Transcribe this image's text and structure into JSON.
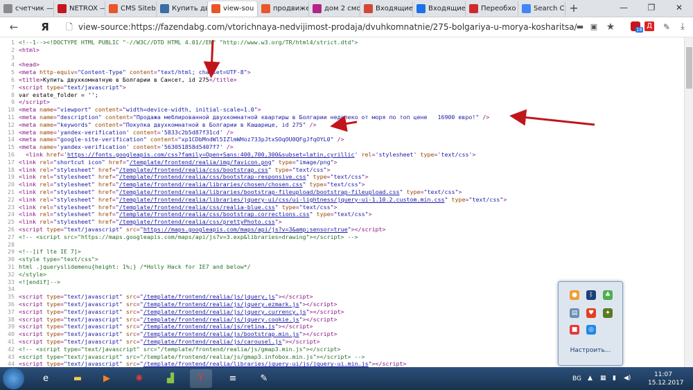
{
  "browser": {
    "tabs": [
      {
        "label": "счетчик —",
        "icon": "page-icon",
        "color": "#8a8a8a"
      },
      {
        "label": "NETROX —",
        "icon": "netrox-icon",
        "color": "#c4161c"
      },
      {
        "label": "CMS Siteb",
        "icon": "s-icon",
        "color": "#e8562a"
      },
      {
        "label": "Купить дву",
        "icon": "house-icon",
        "color": "#3a6ea5"
      },
      {
        "label": "view-sou",
        "icon": "s-icon",
        "color": "#e8562a"
      },
      {
        "label": "продвижен",
        "icon": "s-icon",
        "color": "#e8562a"
      },
      {
        "label": "дом 2 смо",
        "icon": "dom2-icon",
        "color": "#b32485"
      },
      {
        "label": "Входящие",
        "icon": "mail-icon",
        "color": "#d44638"
      },
      {
        "label": "Входящие",
        "icon": "mail-icon",
        "color": "#1a73e8"
      },
      {
        "label": "Переобхо",
        "icon": "search-icon",
        "color": "#cc2b2b"
      },
      {
        "label": "Search Co",
        "icon": "search-icon",
        "color": "#4285f4"
      }
    ],
    "new_tab": "+",
    "url": "view-source:https://fazendabg.com/vtorichnaya-nedvijimost-prodaja/dvuhkomnatnie/275-bolgariya-u-morya-kosharitsa/",
    "yandex_logo": "Я",
    "ext_badge": "18",
    "ext_d": "Д"
  },
  "source_lines": [
    {
      "n": "1",
      "html": "<span class='c'>&lt;!--1--&gt;&lt;!DOCTYPE HTML PUBLIC \"-//W3C//DTD HTML 4.01//EN\" \"http://www.w3.org/TR/html4/strict.dtd\"&gt;</span>"
    },
    {
      "n": "2",
      "html": "&lt;html&gt;"
    },
    {
      "n": "3",
      "html": ""
    },
    {
      "n": "4",
      "html": "&lt;head&gt;"
    },
    {
      "n": "5",
      "html": "&lt;meta <span class='a'>http-equiv</span>=<span class='v'>\"Content-Type\"</span> <span class='a'>content</span>=<span class='v'>\"text/html; charset=UTF-8\"</span>&gt;"
    },
    {
      "n": "6",
      "html": "&lt;title&gt;<span class='t'>Купить двухкомнатную в Болгарии в Сансет, id 275</span>&lt;/title&gt;"
    },
    {
      "n": "7",
      "html": "&lt;script <span class='a'>type</span>=<span class='v'>\"text/javascript\"</span>&gt;"
    },
    {
      "n": "8",
      "html": "<span class='t'>var estate_folder = '';</span>"
    },
    {
      "n": "9",
      "html": "&lt;/script&gt;"
    },
    {
      "n": "10",
      "html": "&lt;meta <span class='a'>name</span>=<span class='v'>\"viewport\"</span> <span class='a'>content</span>=<span class='v'>\"width=device-width, initial-scale=1.0\"</span>&gt;"
    },
    {
      "n": "11",
      "html": "&lt;meta <span class='a'>name</span>=<span class='v'>\"description\"</span> <span class='a'>content</span>=<span class='v'>\"Продажа меблированной двухкомнатной квартиры в Болгарии недалеко от моря по топ цене   16900 евро!\"</span> /&gt;"
    },
    {
      "n": "12",
      "html": "&lt;meta <span class='a'>name</span>=<span class='v'>\"keywords\"</span> <span class='a'>content</span>=<span class='v'>\"Покупка двухкомнатной в Болгарии в Кашарице, id 275\"</span> /&gt;"
    },
    {
      "n": "13",
      "html": "&lt;meta <span class='a'>name</span>=<span class='v'>'yandex-verification'</span> <span class='a'>content</span>=<span class='v'>'5833c2b5d87f31cd'</span> /&gt;"
    },
    {
      "n": "14",
      "html": "&lt;meta <span class='a'>name</span>=<span class='v'>\"google-site-verification\"</span> <span class='a'>content</span>=<span class='v'>\"xp1CDbMndWl5IZlmWHoz733pJtxSOqOU0QFgJfqOYL0\"</span> /&gt;"
    },
    {
      "n": "15",
      "html": "&lt;meta <span class='a'>name</span>=<span class='v'>'yandex-verification'</span> <span class='a'>content</span>=<span class='v'>'563051858d5407f7'</span> /&gt;"
    },
    {
      "n": "16",
      "html": "  &lt;link <span class='a'>href</span>=<span class='v'>'<span class='u'>https://fonts.googleapis.com/css?family=Open+Sans:400,700,300&amp;subset=latin,cyrillic</span>'</span> <span class='a'>rel</span>=<span class='v'>'stylesheet'</span> <span class='a'>type</span>=<span class='v'>'text/css'</span>&gt;"
    },
    {
      "n": "17",
      "html": "&lt;link <span class='a'>rel</span>=<span class='v'>\"shortcut icon\"</span> <span class='a'>href</span>=<span class='v'>\"<span class='u'>/template/frontend/realia/img/favicon.png</span>\"</span> <span class='a'>type</span>=<span class='v'>\"image/png\"</span>&gt;"
    },
    {
      "n": "18",
      "html": "&lt;link <span class='a'>rel</span>=<span class='v'>\"stylesheet\"</span> <span class='a'>href</span>=<span class='v'>\"<span class='u'>/template/frontend/realia/css/bootstrap.css</span>\"</span> <span class='a'>type</span>=<span class='v'>\"text/css\"</span>&gt;"
    },
    {
      "n": "19",
      "html": "&lt;link <span class='a'>rel</span>=<span class='v'>\"stylesheet\"</span> <span class='a'>href</span>=<span class='v'>\"<span class='u'>/template/frontend/realia/css/bootstrap-responsive.css</span>\"</span> <span class='a'>type</span>=<span class='v'>\"text/css\"</span>&gt;"
    },
    {
      "n": "20",
      "html": "&lt;link <span class='a'>rel</span>=<span class='v'>\"stylesheet\"</span> <span class='a'>href</span>=<span class='v'>\"<span class='u'>/template/frontend/realia/libraries/chosen/chosen.css</span>\"</span> <span class='a'>type</span>=<span class='v'>\"text/css\"</span>&gt;"
    },
    {
      "n": "21",
      "html": "&lt;link <span class='a'>rel</span>=<span class='v'>\"stylesheet\"</span> <span class='a'>href</span>=<span class='v'>\"<span class='u'>/template/frontend/realia/libraries/bootstrap-fileupload/bootstrap-fileupload.css</span>\"</span> <span class='a'>type</span>=<span class='v'>\"text/css\"</span>&gt;"
    },
    {
      "n": "22",
      "html": "&lt;link <span class='a'>rel</span>=<span class='v'>\"stylesheet\"</span> <span class='a'>href</span>=<span class='v'>\"<span class='u'>/template/frontend/realia/libraries/jquery-ui/css/ui-lightness/jquery-ui-1.10.2.custom.min.css</span>\"</span> <span class='a'>type</span>=<span class='v'>\"text/css\"</span>&gt;"
    },
    {
      "n": "23",
      "html": "&lt;link <span class='a'>rel</span>=<span class='v'>\"stylesheet\"</span> <span class='a'>href</span>=<span class='v'>\"<span class='u'>/template/frontend/realia/css/realia-blue.css</span>\"</span> <span class='a'>type</span>=<span class='v'>\"text/css\"</span>&gt;"
    },
    {
      "n": "24",
      "html": "&lt;link <span class='a'>rel</span>=<span class='v'>\"stylesheet\"</span> <span class='a'>href</span>=<span class='v'>\"<span class='u'>/template/frontend/realia/css/bootstrap.corrections.css</span>\"</span> <span class='a'>type</span>=<span class='v'>\"text/css\"</span>&gt;"
    },
    {
      "n": "25",
      "html": "&lt;link <span class='a'>rel</span>=<span class='v'>\"stylesheet\"</span> <span class='a'>href</span>=<span class='v'>\"<span class='u'>/template/frontend/realia/css/prettyPhoto.css</span>\"</span>&gt;"
    },
    {
      "n": "26",
      "html": "&lt;script <span class='a'>type</span>=<span class='v'>\"text/javascript\"</span> <span class='a'>src</span>=<span class='v'>\"<span class='u'>https://maps.googleapis.com/maps/api/js?v=3&amp;amp;sensor=true</span>\"</span>&gt;&lt;/script&gt;"
    },
    {
      "n": "27",
      "html": "<span class='c'>&lt;!-- &lt;script src=\"https://maps.googleapis.com/maps/api/js?v=3.exp&amp;libraries=drawing\"&gt;&lt;/script&gt; --&gt;</span>"
    },
    {
      "n": "28",
      "html": ""
    },
    {
      "n": "29",
      "html": "<span class='c'>&lt;!--[if lte IE 7]&gt;</span>"
    },
    {
      "n": "30",
      "html": "<span class='c'>&lt;style type=\"text/css\"&gt;</span>"
    },
    {
      "n": "31",
      "html": "<span class='c'>html .jqueryslidemenu{height: 1%;} /*Holly Hack for IE7 and below*/</span>"
    },
    {
      "n": "32",
      "html": "<span class='c'>&lt;/style&gt;</span>"
    },
    {
      "n": "33",
      "html": "<span class='c'>&lt;![endif]--&gt;</span>"
    },
    {
      "n": "34",
      "html": ""
    },
    {
      "n": "35",
      "html": "&lt;script <span class='a'>type</span>=<span class='v'>\"text/javascript\"</span> <span class='a'>src</span>=<span class='v'>\"<span class='u'>/template/frontend/realia/js/jquery.js</span>\"</span>&gt;&lt;/script&gt;"
    },
    {
      "n": "36",
      "html": "&lt;script <span class='a'>type</span>=<span class='v'>\"text/javascript\"</span> <span class='a'>src</span>=<span class='v'>\"<span class='u'>/template/frontend/realia/js/jquery.ezmark.js</span>\"</span>&gt;&lt;/script&gt;"
    },
    {
      "n": "37",
      "html": "&lt;script <span class='a'>type</span>=<span class='v'>\"text/javascript\"</span> <span class='a'>src</span>=<span class='v'>\"<span class='u'>/template/frontend/realia/js/jquery.currency.js</span>\"</span>&gt;&lt;/script&gt;"
    },
    {
      "n": "38",
      "html": "&lt;script <span class='a'>type</span>=<span class='v'>\"text/javascript\"</span> <span class='a'>src</span>=<span class='v'>\"<span class='u'>/template/frontend/realia/js/jquery.cookie.js</span>\"</span>&gt;&lt;/script&gt;"
    },
    {
      "n": "39",
      "html": "&lt;script <span class='a'>type</span>=<span class='v'>\"text/javascript\"</span> <span class='a'>src</span>=<span class='v'>\"<span class='u'>/template/frontend/realia/js/retina.js</span>\"</span>&gt;&lt;/script&gt;"
    },
    {
      "n": "40",
      "html": "&lt;script <span class='a'>type</span>=<span class='v'>\"text/javascript\"</span> <span class='a'>src</span>=<span class='v'>\"<span class='u'>/template/frontend/realia/js/bootstrap.min.js</span>\"</span>&gt;&lt;/script&gt;"
    },
    {
      "n": "41",
      "html": "&lt;script <span class='a'>type</span>=<span class='v'>\"text/javascript\"</span> <span class='a'>src</span>=<span class='v'>\"<span class='u'>/template/frontend/realia/js/carousel.js</span>\"</span>&gt;&lt;/script&gt;"
    },
    {
      "n": "42",
      "html": "<span class='c'>&lt;!-- &lt;script type=\"text/javascript\" src=\"/template/frontend/realia/js/gmap3.min.js\"&gt;&lt;/script&gt;</span>"
    },
    {
      "n": "43",
      "html": "<span class='c'>&lt;script type=\"text/javascript\" src=\"/template/frontend/realia/js/gmap3.infobox.min.js\"&gt;&lt;/script&gt; --&gt;</span>"
    },
    {
      "n": "44",
      "html": "&lt;script <span class='a'>type</span>=<span class='v'>\"text/javascript\"</span> <span class='a'>src</span>=<span class='v'>\"<span class='u'>/template/frontend/realia/libraries/jquery-ui/js/jquery-ui.min.js</span>\"</span>&gt;&lt;/script&gt;"
    }
  ],
  "tray_popup": {
    "configure_label": "Настроить..."
  },
  "taskbar": {
    "lang": "BG",
    "time": "11:07",
    "date": "15.12.2017"
  }
}
